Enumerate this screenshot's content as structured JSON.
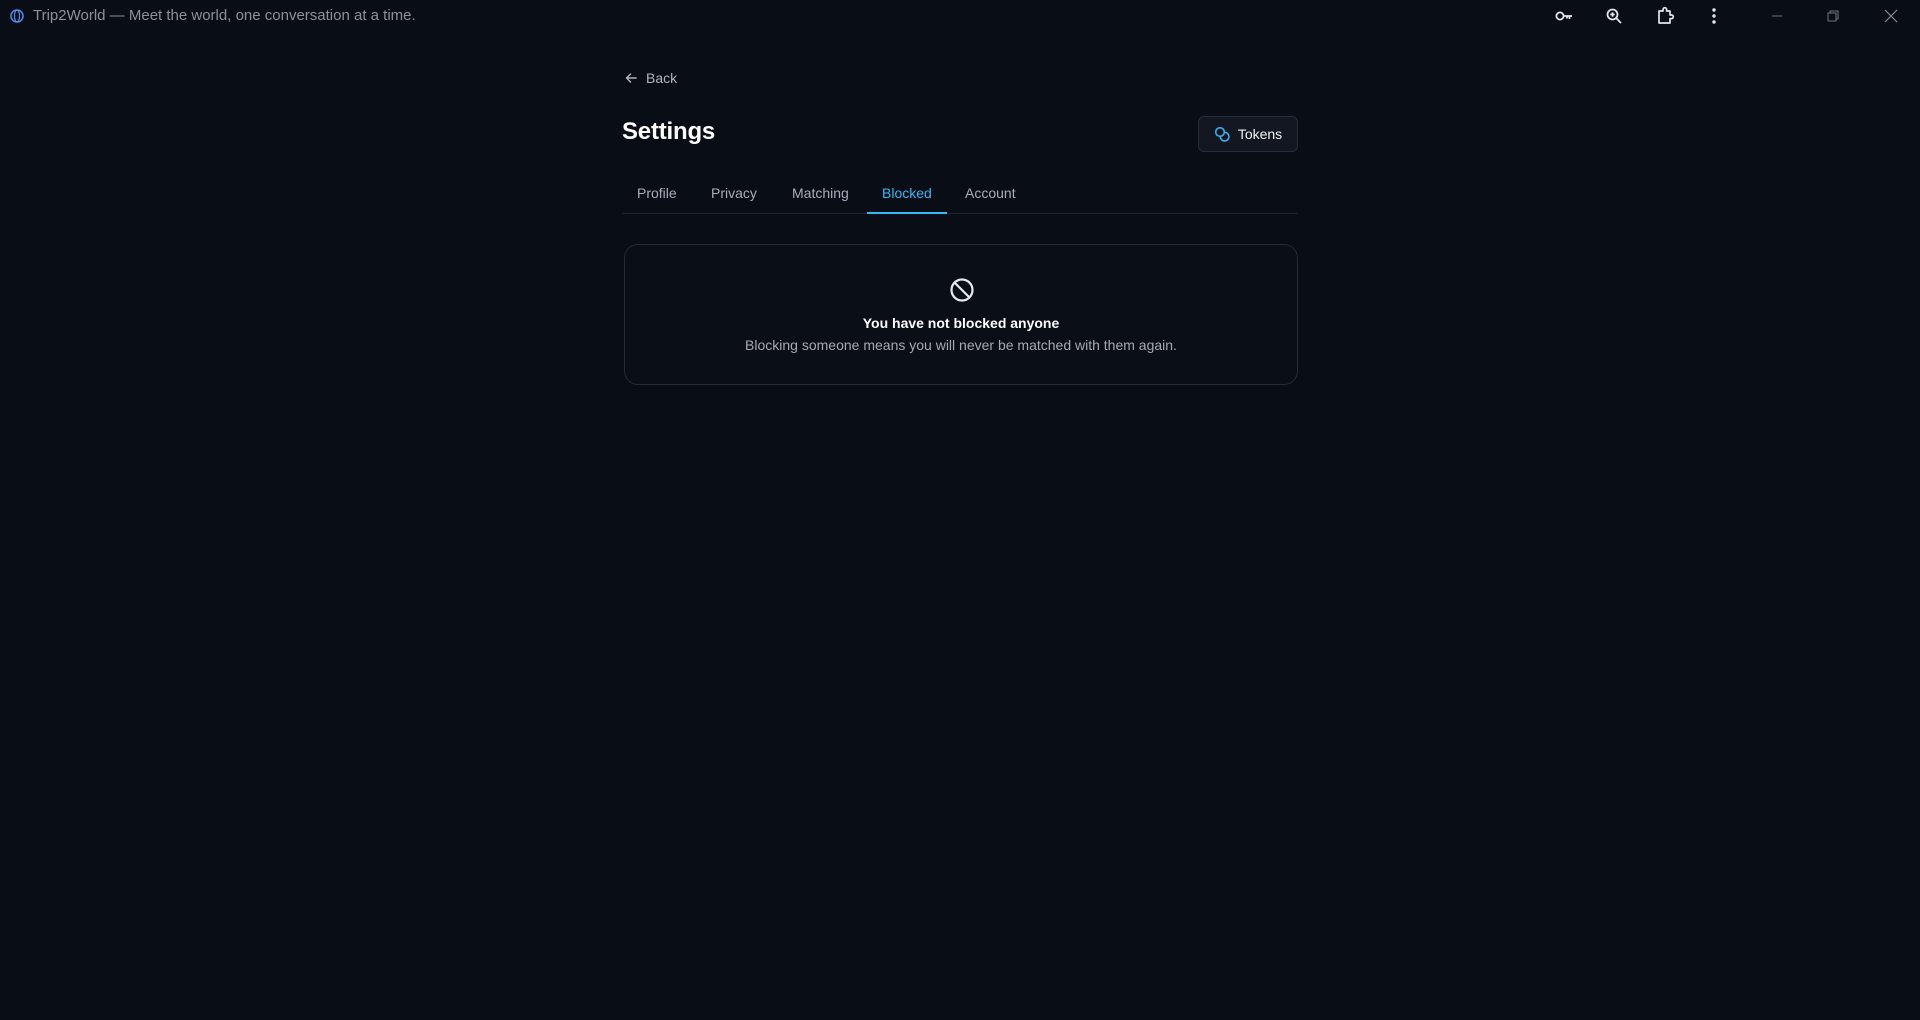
{
  "window": {
    "title": "Trip2World — Meet the world, one conversation at a time.",
    "toolbar_icons": [
      "key-icon",
      "zoom-icon",
      "extensions-icon",
      "more-vertical-icon"
    ],
    "controls": [
      "minimize-icon",
      "restore-icon",
      "close-icon"
    ]
  },
  "page": {
    "back_label": "Back",
    "title": "Settings",
    "tokens_label": "Tokens"
  },
  "tabs": [
    {
      "label": "Profile",
      "active": false
    },
    {
      "label": "Privacy",
      "active": false
    },
    {
      "label": "Matching",
      "active": false
    },
    {
      "label": "Blocked",
      "active": true
    },
    {
      "label": "Account",
      "active": false
    }
  ],
  "empty_state": {
    "icon": "blocked-icon",
    "heading": "You have not blocked anyone",
    "text": "Blocking someone means you will never be matched with them again."
  },
  "colors": {
    "background": "#090d16",
    "accent": "#38b6f5",
    "muted_text": "#a3aab6"
  }
}
